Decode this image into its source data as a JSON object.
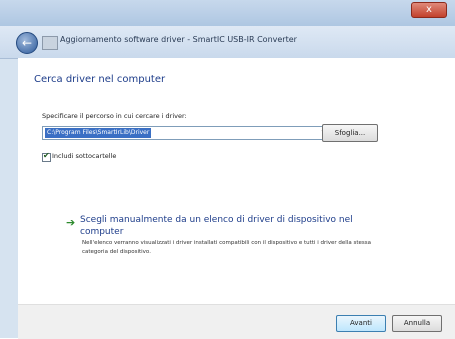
{
  "window": {
    "close_label": "x",
    "nav_title": "Aggiornamento software driver - SmartIC USB-IR Converter"
  },
  "main": {
    "heading": "Cerca driver nel computer",
    "path_label": "Specificare il percorso in cui cercare i driver:",
    "path_value": "C:\\Program Files\\SmartIrLib\\Driver",
    "browse_label": "Sfoglia...",
    "include_subfolders_label": "Includi sottocartelle",
    "include_subfolders_checked": true,
    "option_title": "Scegli manualmente da un elenco di driver di dispositivo nel computer",
    "option_desc": "Nell'elenco verranno visualizzati i driver installati compatibili con il dispositivo e tutti i driver della stessa categoria del dispositivo."
  },
  "footer": {
    "next_label": "Avanti",
    "cancel_label": "Annulla"
  },
  "icons": [
    "back-arrow-icon",
    "device-icon",
    "combo-arrow-icon",
    "green-arrow-icon",
    "close-icon"
  ]
}
